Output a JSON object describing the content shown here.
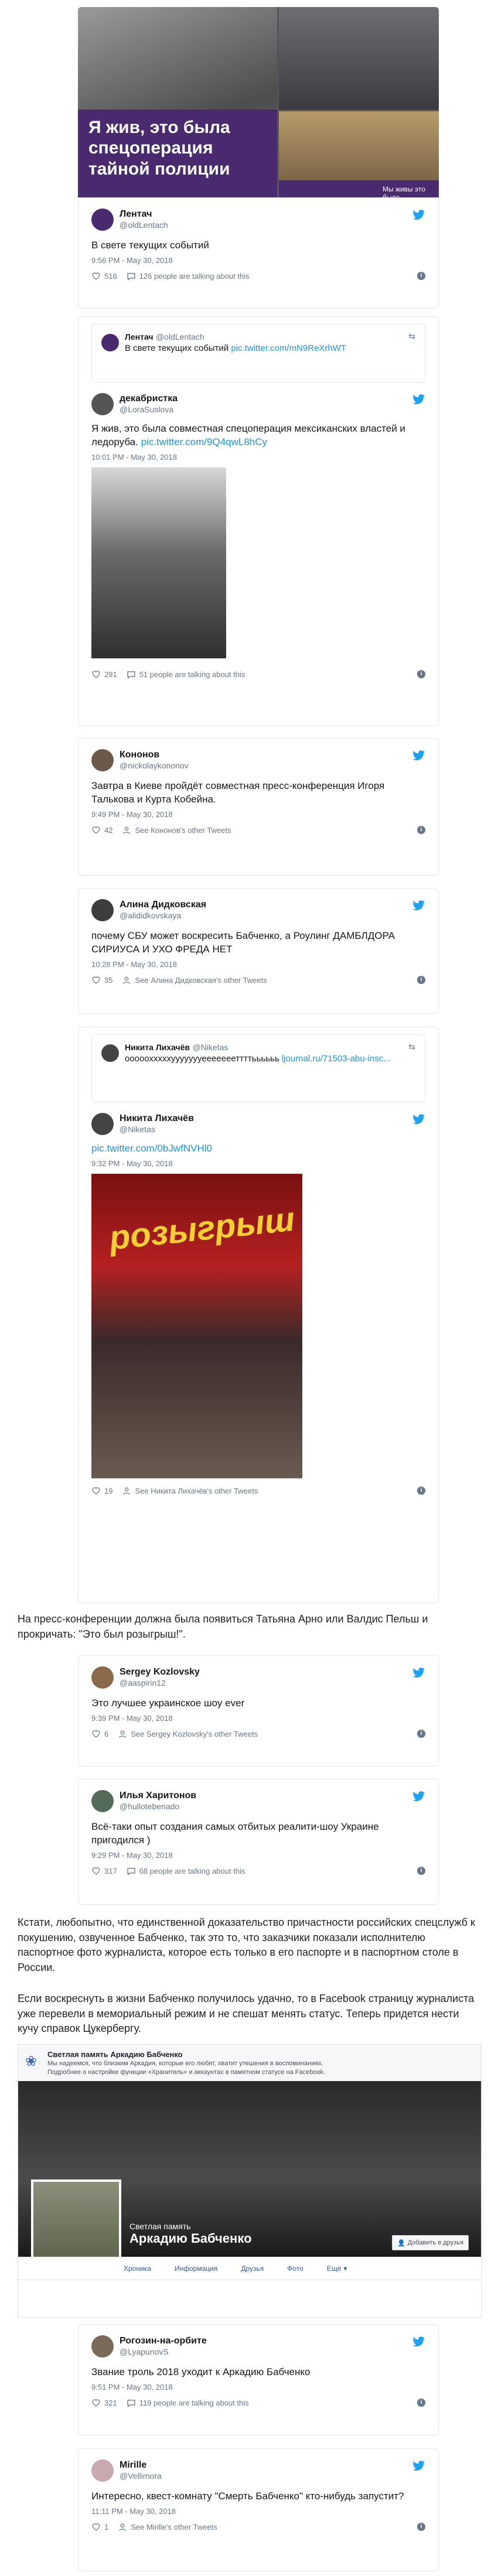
{
  "top_banner": {
    "left_caption": "Я жив, это была спецоперация тайной полиции",
    "right_caption": "Мы живы это была"
  },
  "tweets": [
    {
      "name": "Лентач",
      "handle": "@oldLentach",
      "text": "В свете текущих событий",
      "time": "9:56 PM - May 30, 2018",
      "likes": "516",
      "talk": "126 people are talking about this"
    },
    {
      "quote_name": "Лентач",
      "quote_handle": "@oldLentach",
      "quote_text": "В свете текущих событий",
      "quote_link": "pic.twitter.com/mN9ReXrhWT",
      "name": "декабристка",
      "handle": "@LoraSuslova",
      "text": "Я жив, это была совместная спецоперация мексиканских властей и ледоруба.",
      "link": "pic.twitter.com/9Q4qwL8hCy",
      "time": "10:01 PM - May 30, 2018",
      "likes": "291",
      "talk": "51 people are talking about this"
    },
    {
      "name": "Кононов",
      "handle": "@nickolaykononov",
      "text": "Завтра в Киеве пройдёт совместная пресс-конференция Игоря Талькова и Курта Кобейна.",
      "time": "9:49 PM - May 30, 2018",
      "likes": "42",
      "talk": "See Кононов's other Tweets"
    },
    {
      "name": "Алина Дидковская",
      "handle": "@alididkovskaya",
      "text": "почему СБУ может воскресить Бабченко, а Роулинг ДАМБЛДОРА СИРИУСА И УХО ФРЕДА НЕТ",
      "time": "10:28 PM - May 30, 2018",
      "likes": "35",
      "talk": "See Алина Дидковская's other Tweets"
    },
    {
      "quote_name": "Никита Лихачёв",
      "quote_handle": "@Niketas",
      "quote_text": "ооооохххххуууууууеееееееттттьььььь",
      "quote_link": "ljournal.ru/71503-abu-insc...",
      "name": "Никита Лихачёв",
      "handle": "@Niketas",
      "text": "",
      "link": "pic.twitter.com/0bJwfNVHl0",
      "image_caption": "розыгрыш",
      "time": "9:32 PM - May 30, 2018",
      "likes": "19",
      "talk": "See Никита Лихачёв's other Tweets"
    },
    {
      "name": "Sergey Kozlovsky",
      "handle": "@aaspirin12",
      "text": "Это лучшее украинское шоу ever",
      "time": "9:39 PM - May 30, 2018",
      "likes": "6",
      "talk": "See Sergey Kozlovsky's other Tweets"
    },
    {
      "name": "Илья Харитонов",
      "handle": "@hullotebenado",
      "text": "Всё-таки опыт создания самых отбитых реалити-шоу Украине пригодился )",
      "time": "9:29 PM - May 30, 2018",
      "likes": "317",
      "talk": "68 people are talking about this"
    },
    {
      "name": "Рогозин-на-орбите",
      "handle": "@LyapunovS",
      "text": "Звание троль 2018 уходит к Аркадию Бабченко",
      "time": "9:51 PM - May 30, 2018",
      "likes": "321",
      "talk": "119 people are talking about this"
    },
    {
      "name": "Mirille",
      "handle": "@Vellimora",
      "text": "Интересно, квест-комнату \"Смерть Бабченко\" кто-нибудь запустит?",
      "time": "11:11 PM - May 30, 2018",
      "likes": "1",
      "talk": "See Mirille's other Tweets"
    }
  ],
  "paragraphs": {
    "p1": "На пресс-конференции должна была появиться Татьяна Арно или Валдис Пельш и прокричать: \"Это был розыгрыш!\".",
    "p2": "Кстати, любопытно, что единственной доказательство причастности российских спецслужб к покушению, озвученное Бабченко, так это то, что заказчики показали исполнителю паспортное фото журналиста, которое есть только в его паспорте и в паспортном столе в России.",
    "p3": "Если воскреснуть в жизни Бабченко получилось удачно, то в Facebook страницу журналиста уже перевели в мемориальный режим и не спешат менять статус. Теперь придется нести кучу справок Цукербергу."
  },
  "facebook": {
    "banner_title": "Светлая память Аркадию Бабченко",
    "banner_line1": "Мы надеемся, что близким Аркадия, которые его любят, хватит утешения в воспоминаниях.",
    "banner_line2": "Подробнее о настройке функции «Хранитель» и аккаунтах в памятном статусе на Facebook.",
    "memorial_label": "Светлая память",
    "profile_name": "Аркадию Бабченко",
    "add_friend": "Добавить в друзья",
    "tabs": [
      "Хроника",
      "Информация",
      "Друзья",
      "Фото",
      "Ещё"
    ]
  },
  "colors": {
    "link": "#1b95e0",
    "twitter": "#1da1f2",
    "muted": "#657786"
  }
}
